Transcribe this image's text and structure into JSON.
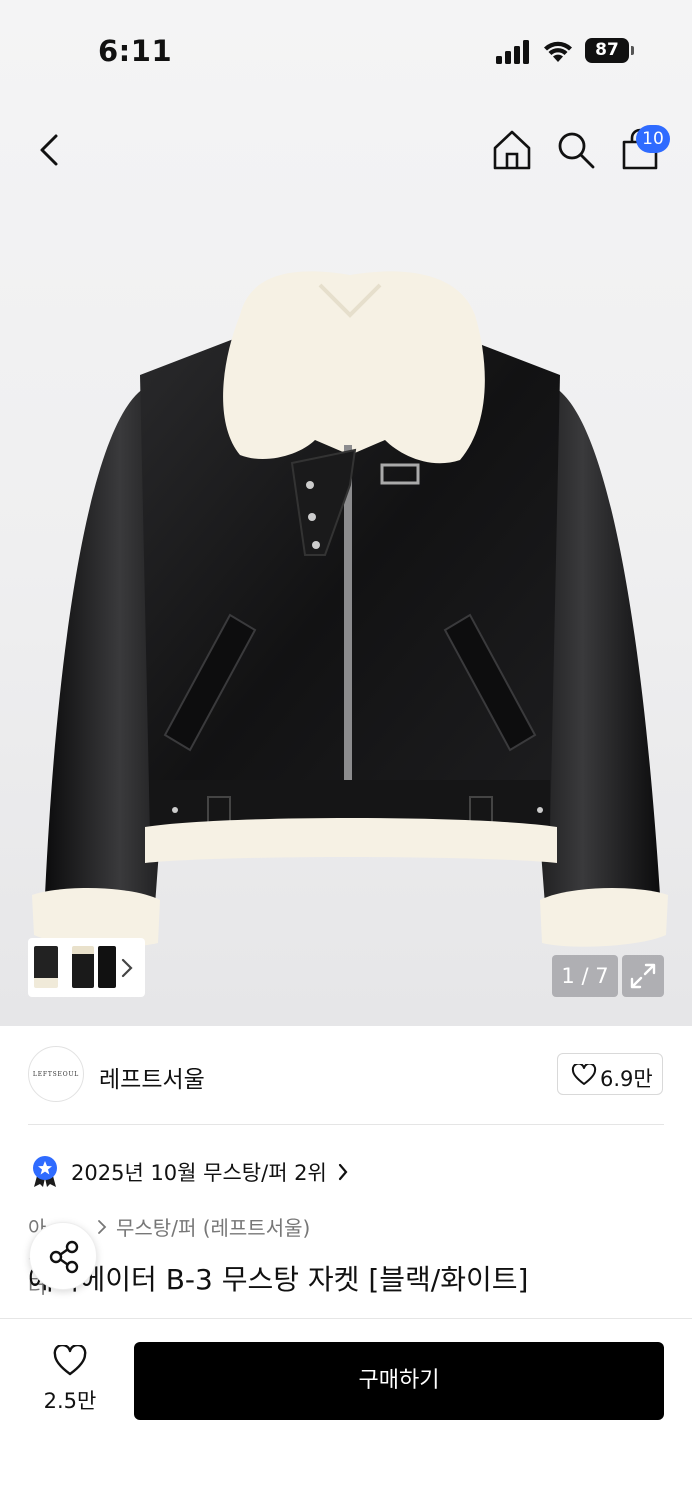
{
  "status_bar": {
    "time": "6:11",
    "battery": "87"
  },
  "nav": {
    "cart_count": "10"
  },
  "gallery": {
    "counter": "1 / 7"
  },
  "brand": {
    "logo_text": "LEFTSEOUL",
    "name": "레프트서울",
    "likes": "6.9만"
  },
  "ranking": {
    "text": "2025년 10월 무스탕/퍼 2위"
  },
  "breadcrumb": {
    "level1": "아우터",
    "level2": "무스탕/퍼 (레프트서울)"
  },
  "product": {
    "title": "에비에이터 B-3 무스탕 자켓 [블랙/화이트]"
  },
  "bottom_bar": {
    "wish_count": "2.5만",
    "buy_label": "구매하기"
  },
  "colors": {
    "accent_blue": "#2f6bff",
    "buy_button": "#000000"
  }
}
